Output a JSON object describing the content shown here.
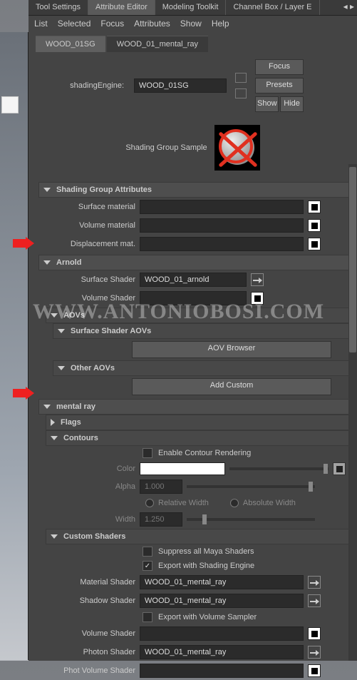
{
  "tabs": {
    "tool_settings": "Tool Settings",
    "attribute_editor": "Attribute Editor",
    "modeling_toolkit": "Modeling Toolkit",
    "channel_box": "Channel Box / Layer E"
  },
  "menu": {
    "list": "List",
    "selected": "Selected",
    "focus": "Focus",
    "attributes": "Attributes",
    "show": "Show",
    "help": "Help"
  },
  "node_tabs": {
    "wood_sg": "WOOD_01SG",
    "wood_mr": "WOOD_01_mental_ray"
  },
  "header": {
    "label": "shadingEngine:",
    "value": "WOOD_01SG",
    "focus": "Focus",
    "presets": "Presets",
    "show": "Show",
    "hide": "Hide"
  },
  "sample_label": "Shading Group Sample",
  "sections": {
    "sga": {
      "title": "Shading Group Attributes",
      "surface_material": "Surface material",
      "volume_material": "Volume material",
      "displacement_mat": "Displacement mat."
    },
    "arnold": {
      "title": "Arnold",
      "surface_shader": "Surface Shader",
      "surface_value": "WOOD_01_arnold",
      "volume_shader": "Volume Shader"
    },
    "aovs": {
      "title": "AOVs",
      "surface_aovs": "Surface Shader AOVs",
      "browser": "AOV Browser",
      "other": "Other AOVs",
      "add_custom": "Add Custom"
    },
    "mentalray": {
      "title": "mental ray",
      "flags": "Flags",
      "contours": "Contours",
      "enable_contour": "Enable Contour Rendering",
      "color": "Color",
      "alpha": "Alpha",
      "alpha_val": "1.000",
      "relative": "Relative Width",
      "absolute": "Absolute Width",
      "width": "Width",
      "width_val": "1.250",
      "custom_shaders": "Custom Shaders",
      "suppress": "Suppress all Maya Shaders",
      "export_se": "Export with Shading Engine",
      "material_shader": "Material Shader",
      "material_val": "WOOD_01_mental_ray",
      "shadow_shader": "Shadow Shader",
      "shadow_val": "WOOD_01_mental_ray",
      "export_vs": "Export with Volume Sampler",
      "volume_shader": "Volume Shader",
      "photon_shader": "Photon Shader",
      "photon_val": "WOOD_01_mental_ray",
      "phot_vol": "Phot Volume Shader"
    }
  },
  "watermark": "WWW.ANTONIOBOSI.COM"
}
